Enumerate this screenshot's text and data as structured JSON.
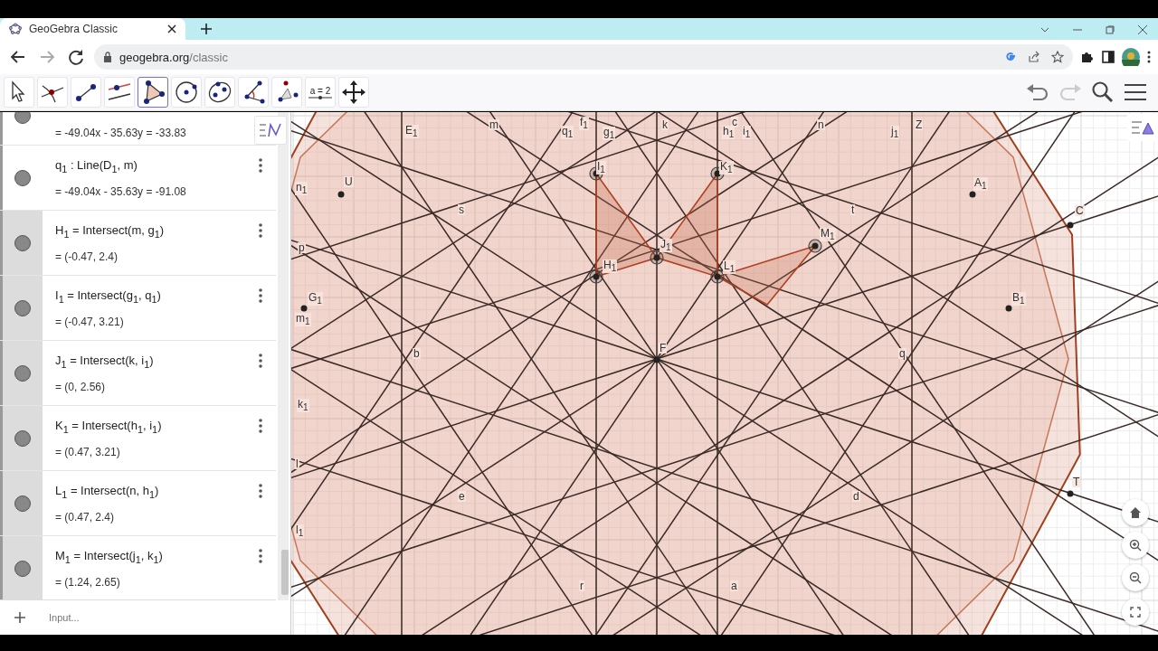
{
  "browser": {
    "tab_title": "GeoGebra Classic",
    "url_host": "geogebra.org",
    "url_path": "/classic"
  },
  "toolbar": {
    "tools": [
      {
        "kind": "move",
        "selected": false
      },
      {
        "kind": "intersect",
        "selected": false
      },
      {
        "kind": "segment",
        "selected": false
      },
      {
        "kind": "parallel",
        "selected": false
      },
      {
        "kind": "polygon",
        "selected": true
      },
      {
        "kind": "circle",
        "selected": false
      },
      {
        "kind": "conic",
        "selected": false
      },
      {
        "kind": "angle",
        "selected": false
      },
      {
        "kind": "reflect",
        "selected": false
      },
      {
        "kind": "slider",
        "selected": false,
        "label": "a = 2"
      },
      {
        "kind": "move-view",
        "selected": false
      }
    ]
  },
  "algebra": {
    "rows": [
      {
        "value": "= -49.04x - 35.63y = -33.83",
        "selected": false
      },
      {
        "definition": "q$_{1}$ : Line(D$_{1}$, m)",
        "value": "= -49.04x - 35.63y = -91.08",
        "selected": false
      },
      {
        "definition": "H$_{1}$ = Intersect(m, g$_{1}$)",
        "value": "= (-0.47, 2.4)",
        "selected": true
      },
      {
        "definition": "I$_{1}$ = Intersect(g$_{1}$, q$_{1}$)",
        "value": "= (-0.47, 3.21)",
        "selected": true
      },
      {
        "definition": "J$_{1}$ = Intersect(k, i$_{1}$)",
        "value": "= (0, 2.56)",
        "selected": true
      },
      {
        "definition": "K$_{1}$ = Intersect(h$_{1}$, i$_{1}$)",
        "value": "= (0.47, 3.21)",
        "selected": true
      },
      {
        "definition": "L$_{1}$ = Intersect(n, h$_{1}$)",
        "value": "= (0.47, 2.4)",
        "selected": true
      },
      {
        "definition": "M$_{1}$ = Intersect(j$_{1}$, k$_{1}$)",
        "value": "= (1.24, 2.65)",
        "selected": true
      }
    ],
    "input_placeholder": "Input..."
  },
  "canvas_labels": [
    "E$_{1}$",
    "m",
    "q$_{1}$",
    "f$_{1}$",
    "g$_{1}$",
    "k",
    "h$_{1}$",
    "c",
    "i$_{1}$",
    "n",
    "j$_{1}$",
    "Z",
    "n$_{1}$",
    "U",
    "s",
    "I$_{1}$",
    "K$_{1}$",
    "A$_{1}$",
    "t",
    "C",
    "M$_{1}$",
    "p",
    "J$_{1}$",
    "H$_{1}$",
    "L$_{1}$",
    "G$_{1}$",
    "B$_{1}$",
    "m$_{1}$",
    "b",
    "F",
    "q",
    "k$_{1}$",
    "l",
    "e",
    "d",
    "T",
    "l$_{1}$",
    "r",
    "a"
  ]
}
